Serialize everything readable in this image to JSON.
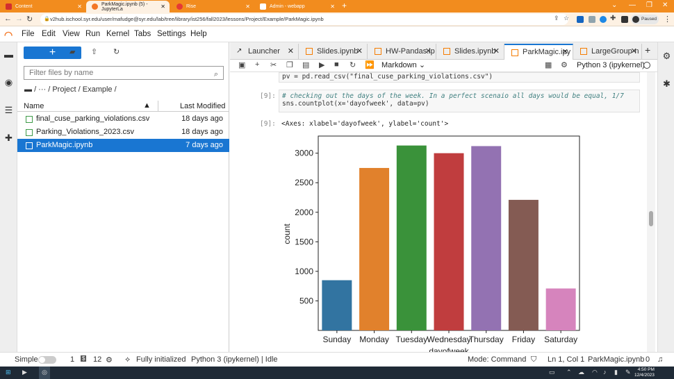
{
  "browser": {
    "tabs": [
      {
        "label": "Content",
        "active": false
      },
      {
        "label": "ParkMagic.ipynb (5) - JupyterLa",
        "active": true
      },
      {
        "label": "Rise",
        "active": false
      },
      {
        "label": "Admin - webapp",
        "active": false
      }
    ],
    "url": "v2hub.ischool.syr.edu/user/mafudge@syr.edu/lab/tree/library/ist256/fall2023/lessons/Project/Example/ParkMagic.ipynb",
    "profile_status": "Paused"
  },
  "menu": [
    "File",
    "Edit",
    "View",
    "Run",
    "Kernel",
    "Tabs",
    "Settings",
    "Help"
  ],
  "filebrowser": {
    "new_label": "+",
    "filter_placeholder": "Filter files by name",
    "breadcrumb": "/ ··· / Project / Example /",
    "col_name": "Name",
    "col_modified": "Last Modified",
    "files": [
      {
        "name": "final_cuse_parking_violations.csv",
        "modified": "18 days ago",
        "selected": false
      },
      {
        "name": "Parking_Violations_2023.csv",
        "modified": "18 days ago",
        "selected": false
      },
      {
        "name": "ParkMagic.ipynb",
        "modified": "7 days ago",
        "selected": true
      }
    ]
  },
  "notebook": {
    "tabs": [
      {
        "label": "Launcher"
      },
      {
        "label": "Slides.ipynb"
      },
      {
        "label": "HW-Pandas.ip"
      },
      {
        "label": "Slides.ipynb"
      },
      {
        "label": "ParkMagic.ipy",
        "active": true
      },
      {
        "label": "LargeGroup-n"
      }
    ],
    "cell_type": "Markdown",
    "kernel": "Python 3 (ipykernel)",
    "code_line_prev": "pv = pd.read_csv(\"final_cuse_parking_violations.csv\")",
    "prompt_in": "[9]:",
    "comment": "# checking out the days of the week. In a perfect scenaio all days would be equal, 1/7",
    "code_line": "sns.countplot(x='dayofweek', data=pv)",
    "prompt_out": "[9]:",
    "output_text": "<Axes: xlabel='dayofweek', ylabel='count'>"
  },
  "chart_data": {
    "type": "bar",
    "categories": [
      "Sunday",
      "Monday",
      "Tuesday",
      "Wednesday",
      "Thursday",
      "Friday",
      "Saturday"
    ],
    "values": [
      850,
      2750,
      3130,
      3000,
      3120,
      2210,
      710
    ],
    "colors": [
      "#3274a1",
      "#e1812c",
      "#3a923a",
      "#c03d3e",
      "#9372b2",
      "#845b53",
      "#d684bd"
    ],
    "xlabel": "dayofweek",
    "ylabel": "count",
    "ylim": [
      0,
      3290
    ],
    "yticks": [
      500,
      1000,
      1500,
      2000,
      2500,
      3000
    ]
  },
  "statusbar": {
    "mode": "Simple",
    "count1": "1",
    "count2": "12",
    "init": "Fully initialized",
    "kernel_status": "Python 3 (ipykernel) | Idle",
    "command": "Mode: Command",
    "position": "Ln 1, Col 1",
    "file": "ParkMagic.ipynb",
    "count3": "0"
  },
  "taskbar": {
    "time": "4:50 PM",
    "date": "12/4/2023"
  }
}
